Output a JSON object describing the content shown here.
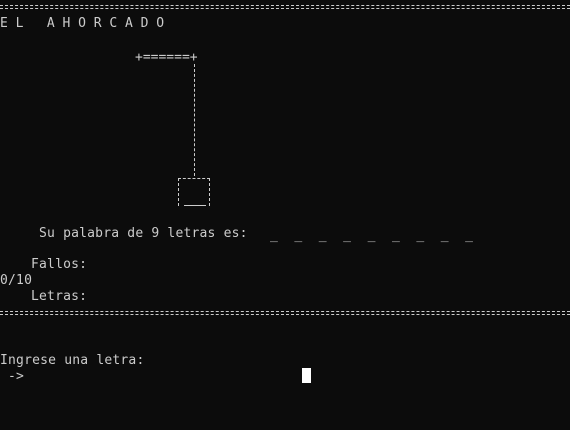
{
  "title": "EL AHORCADO",
  "gallows_top": "+======+",
  "prompt_word": "Su palabra de 9 letras es:",
  "word_slots": [
    "_",
    "_",
    "_",
    "_",
    "_",
    "_",
    "_",
    "_",
    "_"
  ],
  "fails_label": "Fallos:",
  "fails_value": "0/10",
  "letters_label": "Letras:",
  "input_prompt": "Ingrese una letra:",
  "input_arrow": "->"
}
